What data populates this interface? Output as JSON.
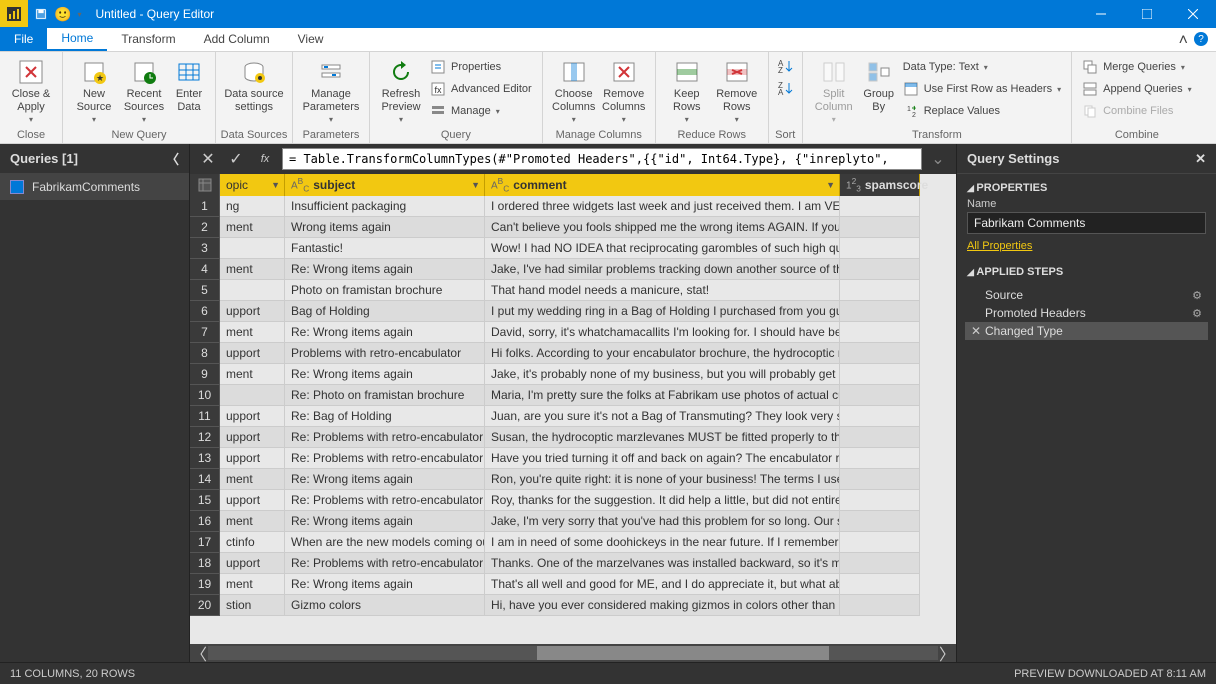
{
  "window_title": "Untitled - Query Editor",
  "ribbon": {
    "file": "File",
    "tabs": {
      "home": "Home",
      "transform": "Transform",
      "addcol": "Add Column",
      "view": "View"
    },
    "close_apply": "Close &\nApply",
    "groups": {
      "close": "Close",
      "newquery": "New Query",
      "datasources": "Data Sources",
      "parameters": "Parameters",
      "query": "Query",
      "managecols": "Manage Columns",
      "reducerows": "Reduce Rows",
      "sort": "Sort",
      "transform": "Transform",
      "combine": "Combine"
    },
    "new_source": "New\nSource",
    "recent_sources": "Recent\nSources",
    "enter_data": "Enter\nData",
    "data_source_settings": "Data source\nsettings",
    "manage_params": "Manage\nParameters",
    "refresh_preview": "Refresh\nPreview",
    "properties": "Properties",
    "advanced_editor": "Advanced Editor",
    "manage": "Manage",
    "choose_cols": "Choose\nColumns",
    "remove_cols": "Remove\nColumns",
    "keep_rows": "Keep\nRows",
    "remove_rows": "Remove\nRows",
    "split_col": "Split\nColumn",
    "group_by": "Group\nBy",
    "data_type": "Data Type: Text",
    "first_row_headers": "Use First Row as Headers",
    "replace_values": "Replace Values",
    "merge_queries": "Merge Queries",
    "append_queries": "Append Queries",
    "combine_files": "Combine Files"
  },
  "queries_panel": {
    "title": "Queries [1]",
    "items": [
      "FabrikamComments"
    ]
  },
  "formula": "= Table.TransformColumnTypes(#\"Promoted Headers\",{{\"id\", Int64.Type}, {\"inreplyto\",",
  "columns": {
    "topic": "opic",
    "subject": "subject",
    "comment": "comment",
    "spamscore": "spamscore"
  },
  "rows": [
    {
      "n": 1,
      "topic": "ng",
      "subject": "Insufficient packaging",
      "comment": "I ordered three widgets last week and just received them. I am VERY di..."
    },
    {
      "n": 2,
      "topic": "ment",
      "subject": "Wrong items again",
      "comment": "Can't believe you fools shipped me the wrong items AGAIN. If you wer..."
    },
    {
      "n": 3,
      "topic": "",
      "subject": "Fantastic!",
      "comment": "Wow! I had NO IDEA that reciprocating garombles of such high quality ..."
    },
    {
      "n": 4,
      "topic": "ment",
      "subject": "Re: Wrong items again",
      "comment": "Jake, I've had similar problems tracking down another source of thinga..."
    },
    {
      "n": 5,
      "topic": "",
      "subject": "Photo on framistan brochure",
      "comment": "That hand model needs a manicure, stat!"
    },
    {
      "n": 6,
      "topic": "upport",
      "subject": "Bag of Holding",
      "comment": "I put my wedding ring in a Bag of Holding I purchased from you guys (f..."
    },
    {
      "n": 7,
      "topic": "ment",
      "subject": "Re: Wrong items again",
      "comment": "David, sorry, it's whatchamacallits I'm looking for. I should have been ..."
    },
    {
      "n": 8,
      "topic": "upport",
      "subject": "Problems with retro-encabulator",
      "comment": "Hi folks. According to your encabulator brochure, the hydrocoptic mar..."
    },
    {
      "n": 9,
      "topic": "ment",
      "subject": "Re: Wrong items again",
      "comment": "Jake, it's probably none of my business, but you will probably get a bet..."
    },
    {
      "n": 10,
      "topic": "",
      "subject": "Re: Photo on framistan brochure",
      "comment": "Maria, I'm pretty sure the folks at Fabrikam use photos of actual custo..."
    },
    {
      "n": 11,
      "topic": "upport",
      "subject": "Re: Bag of Holding",
      "comment": "Juan, are you sure it's not a Bag of Transmuting? They look very simila..."
    },
    {
      "n": 12,
      "topic": "upport",
      "subject": "Re: Problems with retro-encabulator",
      "comment": "Susan, the hydrocoptic marzlevanes MUST be fitted properly to the a..."
    },
    {
      "n": 13,
      "topic": "upport",
      "subject": "Re: Problems with retro-encabulator",
      "comment": "Have you tried turning it off and back on again? The encabulator runs ..."
    },
    {
      "n": 14,
      "topic": "ment",
      "subject": "Re: Wrong items again",
      "comment": "Ron, you're quite right: it is none of your business! The terms I used ar..."
    },
    {
      "n": 15,
      "topic": "upport",
      "subject": "Re: Problems with retro-encabulator",
      "comment": "Roy, thanks for the suggestion. It did help a little, but did not entirely e..."
    },
    {
      "n": 16,
      "topic": "ment",
      "subject": "Re: Wrong items again",
      "comment": "Jake, I'm very sorry that you've had this problem for so long. Our syste..."
    },
    {
      "n": 17,
      "topic": "ctinfo",
      "subject": "When are the new models coming out?",
      "comment": "I am in need of some doohickeys in the near future. If I remember corr..."
    },
    {
      "n": 18,
      "topic": "upport",
      "subject": "Re: Problems with retro-encabulator",
      "comment": "Thanks. One of the marzelvanes was installed backward, so it's my faul..."
    },
    {
      "n": 19,
      "topic": "ment",
      "subject": "Re: Wrong items again",
      "comment": "That's all well and good for ME, and I do appreciate it, but what about ..."
    },
    {
      "n": 20,
      "topic": "stion",
      "subject": "Gizmo colors",
      "comment": "Hi, have you ever considered making gizmos in colors other than chart..."
    }
  ],
  "settings": {
    "title": "Query Settings",
    "props": "PROPERTIES",
    "name_label": "Name",
    "name_value": "Fabrikam Comments",
    "all_props": "All Properties",
    "applied_steps": "APPLIED STEPS",
    "steps": [
      "Source",
      "Promoted Headers",
      "Changed Type"
    ]
  },
  "status": {
    "left": "11 COLUMNS, 20 ROWS",
    "right": "PREVIEW DOWNLOADED AT 8:11 AM"
  }
}
